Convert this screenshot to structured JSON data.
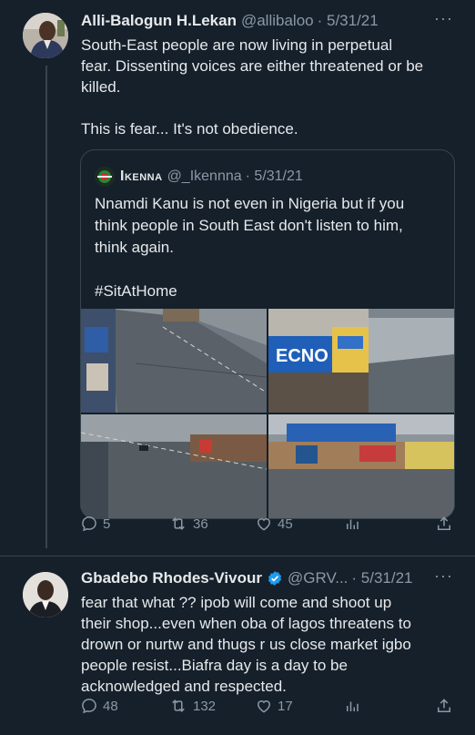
{
  "tweet1": {
    "name": "Alli-Balogun H.Lekan",
    "handle": "@allibaloo",
    "date": "· 5/31/21",
    "text_lines": [
      "South-East people are now living in perpetual",
      "fear. Dissenting voices are either threatened or be",
      "killed.",
      "",
      "This is fear... It's not obedience."
    ],
    "quote": {
      "name": "Ikenna",
      "handle": "@_Ikennna",
      "date": "· 5/31/21",
      "text_lines": [
        "Nnamdi Kanu is not even in Nigeria but if you",
        "think people in South East don't listen to him,",
        "think again.",
        "",
        "#SitAtHome"
      ],
      "photo_sign_text": "ECNO"
    },
    "actions": {
      "replies": "5",
      "retweets": "36",
      "likes": "45"
    }
  },
  "tweet2": {
    "name": "Gbadebo Rhodes-Vivour",
    "handle": "@GRV...",
    "date": "· 5/31/21",
    "verified": true,
    "text_lines": [
      "fear that what ?? ipob will come and shoot up",
      "their shop...even when oba of lagos threatens to",
      "drown or nurtw and thugs r us close market igbo",
      "people resist...Biafra day is a day to be",
      "acknowledged and respected."
    ],
    "actions": {
      "replies": "48",
      "retweets": "132",
      "likes": "17"
    }
  },
  "icons": {
    "reply": "reply-icon",
    "retweet": "retweet-icon",
    "like": "heart-icon",
    "views": "analytics-icon",
    "share": "share-icon",
    "more": "more-icon",
    "verified": "verified-badge-icon"
  },
  "colors": {
    "background": "#15202b",
    "text": "#e7e9ea",
    "muted": "#8b98a5",
    "border": "#38444d",
    "verified": "#1d9bf0"
  }
}
